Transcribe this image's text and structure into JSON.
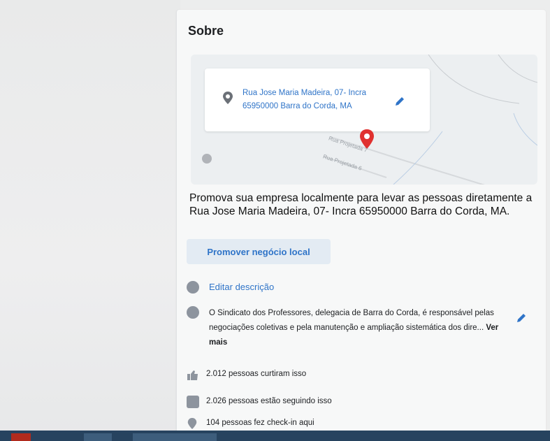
{
  "about": {
    "title": "Sobre",
    "address": "Rua Jose Maria Madeira, 07- Incra 65950000 Barra do Corda, MA",
    "map_street_1": "Rua Projetada 7",
    "map_street_2": "Rua Projetada 6",
    "promo_text": "Promova sua empresa localmente para levar as pessoas diretamente a Rua Jose Maria Madeira, 07- Incra 65950000 Barra do Corda, MA.",
    "promote_button": "Promover negócio local",
    "edit_description": "Editar descrição",
    "description": "O Sindicato dos Professores, delegacia de Barra do Corda, é responsável pelas negociações coletivas e pela manutenção e ampliação sistemática dos dire...",
    "see_more": "Ver mais",
    "likes": "2.012 pessoas curtiram isso",
    "followers": "2.026 pessoas estão seguindo isso",
    "checkins": "104 pessoas fez check-in aqui"
  },
  "colors": {
    "link": "#2f74c8",
    "pin": "#e0312f",
    "icon_gray": "#8d949e",
    "taskbar": "#27435f"
  },
  "icons": [
    "location-pin-icon",
    "pencil-icon",
    "info-icon",
    "like-icon",
    "follow-icon",
    "checkin-icon"
  ]
}
